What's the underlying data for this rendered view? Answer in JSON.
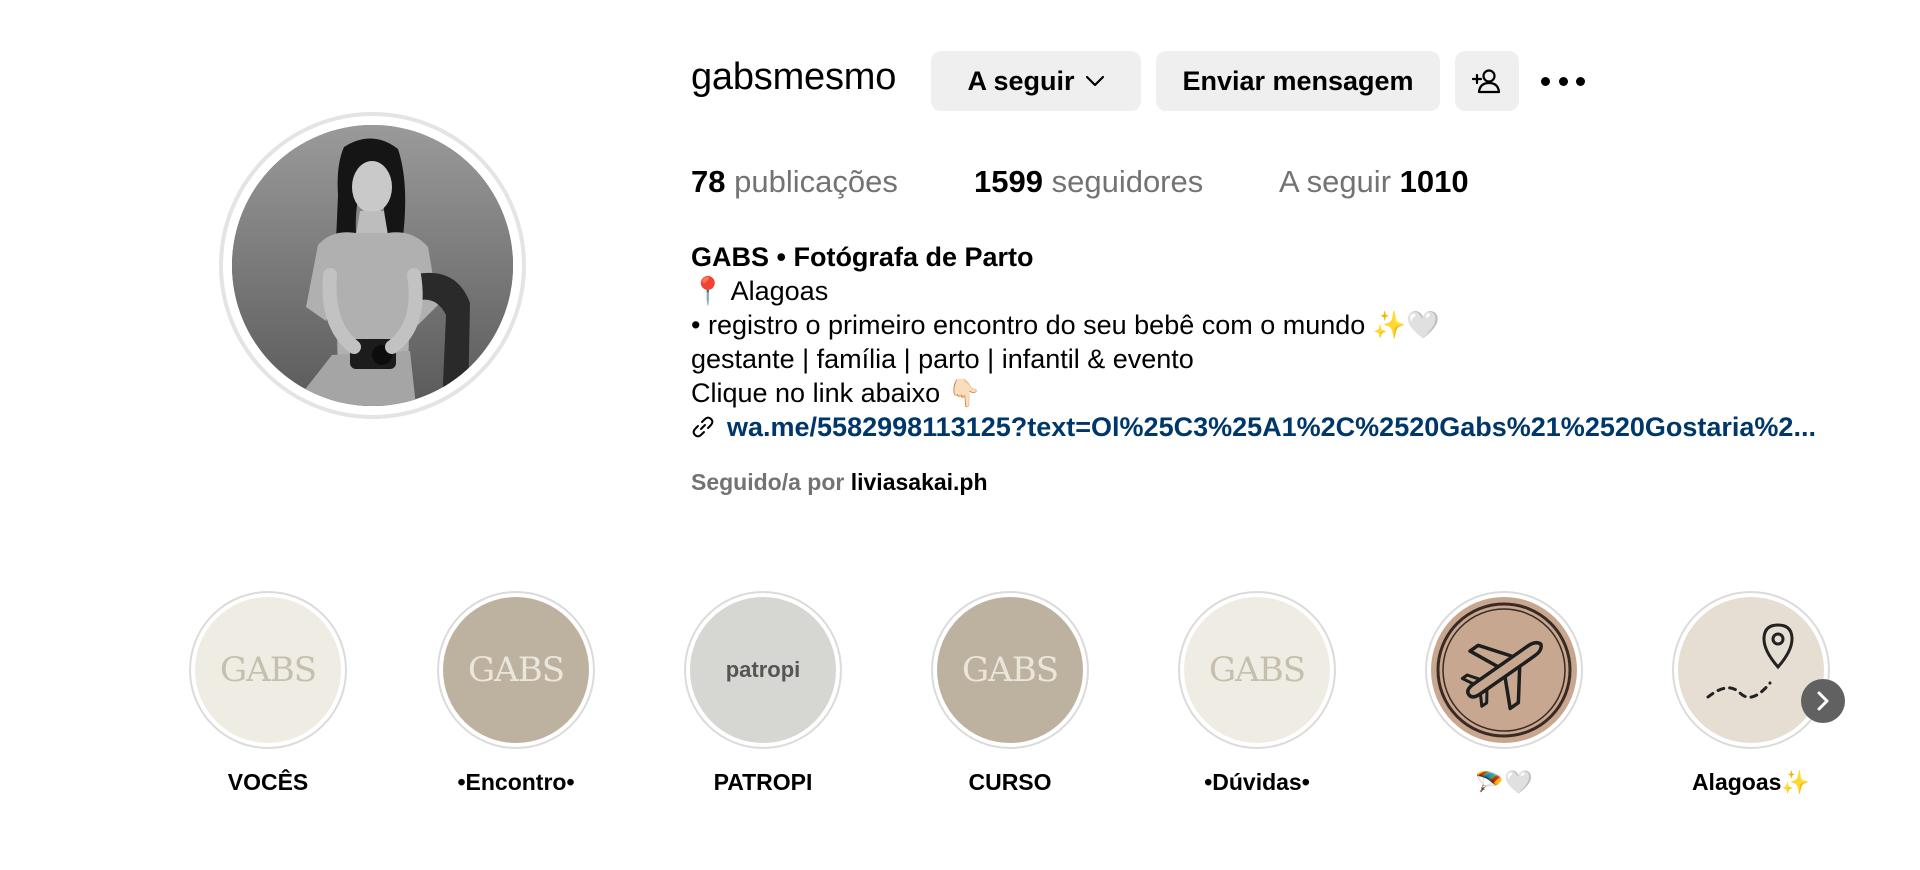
{
  "profile": {
    "username": "gabsmesmo",
    "following_button": "A seguir",
    "message_button": "Enviar mensagem"
  },
  "stats": {
    "posts_count": "78",
    "posts_label": "publicações",
    "followers_count": "1599",
    "followers_label": "seguidores",
    "following_label": "A seguir",
    "following_count": "1010"
  },
  "bio": {
    "name": "GABS • Fotógrafa de Parto",
    "line1": "📍 Alagoas",
    "line2": "• registro o primeiro encontro do seu bebê com o mundo ✨🤍",
    "line3": "gestante | família | parto | infantil & evento",
    "line4": "Clique no link abaixo 👇🏻",
    "link": "wa.me/5582998113125?text=Ol%25C3%25A1%2C%2520Gabs%21%2520Gostaria%2..."
  },
  "followed_by": {
    "prefix": "Seguido/a por",
    "user": "liviasakai.ph"
  },
  "highlights": [
    {
      "label": "VOCÊS",
      "cover_text": "GABS",
      "bg": "#efede3",
      "fg": "#c6bfae"
    },
    {
      "label": "•Encontro•",
      "cover_text": "GABS",
      "bg": "#bdb29f",
      "fg": "#ebe6dc"
    },
    {
      "label": "PATROPI",
      "cover_text": "patropi",
      "bg": "#d9d9d5",
      "fg": "#5a5a5a"
    },
    {
      "label": "CURSO",
      "cover_text": "GABS",
      "bg": "#bdb29f",
      "fg": "#ebe6dc"
    },
    {
      "label": "•Dúvidas•",
      "cover_text": "GABS",
      "bg": "#efede3",
      "fg": "#c6bfae"
    },
    {
      "label": "🪂🤍",
      "cover_text": "",
      "bg": "#c7a78f",
      "fg": "#2a2a2a"
    },
    {
      "label": "Alagoas✨",
      "cover_text": "",
      "bg": "#e6ddd3",
      "fg": "#2a2a2a"
    }
  ],
  "colors": {
    "button_bg": "#efefef",
    "link": "#00376b",
    "muted": "#737373"
  },
  "icons": [
    "chevron-down-icon",
    "add-person-icon",
    "more-icon",
    "link-icon",
    "airplane-icon",
    "location-pin-icon",
    "chevron-right-icon"
  ]
}
